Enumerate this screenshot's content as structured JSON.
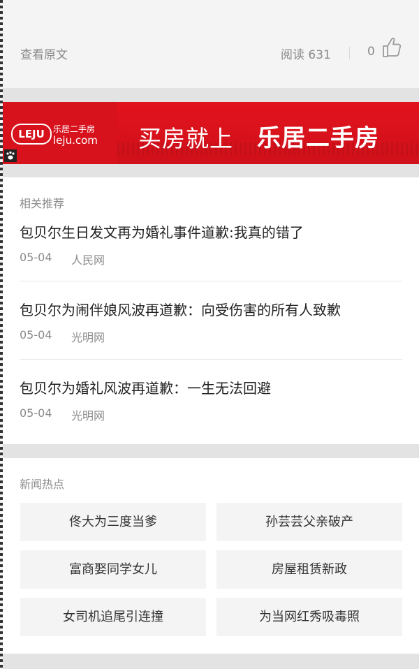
{
  "toolbar": {
    "view_original_label": "查看原文",
    "read_label": "阅读",
    "read_count": "631",
    "like_count": "0"
  },
  "ad": {
    "logo_text": "LEJU",
    "brand_cn": "乐居二手房",
    "brand_url": "leju.com",
    "slogan_prefix": "买房就上",
    "slogan_brand": "乐居二手房",
    "accent_color": "#d7121c"
  },
  "related": {
    "title": "相关推荐",
    "articles": [
      {
        "title": "包贝尔生日发文再为婚礼事件道歉:我真的错了",
        "date": "05-04",
        "source": "人民网"
      },
      {
        "title": "包贝尔为闹伴娘风波再道歉：向受伤害的所有人致歉",
        "date": "05-04",
        "source": "光明网"
      },
      {
        "title": "包贝尔为婚礼风波再道歉：一生无法回避",
        "date": "05-04",
        "source": "光明网"
      }
    ]
  },
  "hot": {
    "title": "新闻热点",
    "tags": [
      "佟大为三度当爹",
      "孙芸芸父亲破产",
      "富商娶同学女儿",
      "房屋租赁新政",
      "女司机追尾引连撞",
      "为当网红秀吸毒照"
    ]
  },
  "icons": {
    "like": "thumbs-up-icon",
    "paw": "paw-icon"
  }
}
